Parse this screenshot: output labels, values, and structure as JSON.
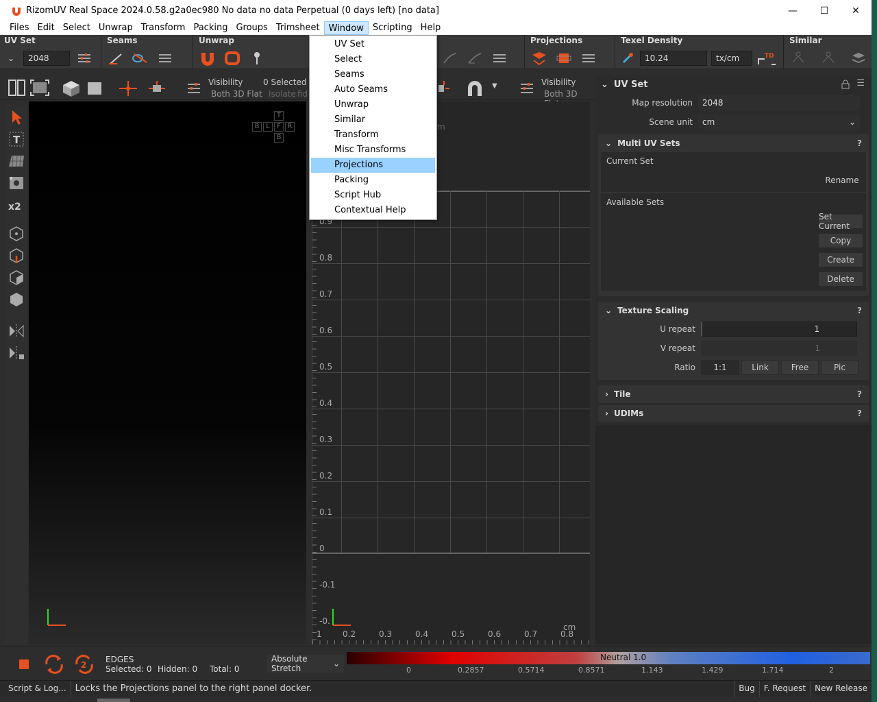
{
  "window": {
    "title": "RizomUV  Real Space 2024.0.58.g2a0ec980 No data no data Perpetual  (0 days left) [no data]",
    "minimize": "—",
    "maximize": "☐",
    "close": "✕"
  },
  "menu": [
    "Files",
    "Edit",
    "Select",
    "Unwrap",
    "Transform",
    "Packing",
    "Groups",
    "Trimsheet",
    "Window",
    "Scripting",
    "Help"
  ],
  "active_menu": "Window",
  "window_menu": {
    "items": [
      "UV Set",
      "Select",
      "Seams",
      "Auto Seams",
      "Unwrap",
      "Similar",
      "Transform",
      "Misc Transforms",
      "Projections",
      "Packing",
      "Script Hub",
      "Contextual Help"
    ],
    "highlighted": "Projections"
  },
  "toolbar": {
    "uvset_title": "UV Set",
    "uvset_value": "2048",
    "seams_title": "Seams",
    "unwrap_title": "Unwrap",
    "projections_title": "Projections",
    "texel_title": "Texel Density",
    "texel_value": "10.24",
    "texel_unit": "tx/cm",
    "similar_title": "Similar"
  },
  "viewbar": {
    "visibility_label": "Visibility",
    "visibility_mode": "Both 3D Flat",
    "selected_count": "0 Selected",
    "isolate": "Isolate",
    "fid": "fid",
    "visibility_label_2": "Visibility",
    "visibility_mode_2": "Both 3D Flat"
  },
  "cube_nav": {
    "top": "T",
    "back": "B",
    "left": "L",
    "front": "F",
    "right": "R",
    "bottom": "B"
  },
  "uv_axis": {
    "y_ticks": [
      "0.9",
      "0.8",
      "0.7",
      "0.6",
      "0.5",
      "0.4",
      "0.3",
      "0.2",
      "0.1",
      "0",
      "-0.1",
      "-0."
    ],
    "x_ticks": [
      "1",
      "0.2",
      "0.3",
      "0.4",
      "0.5",
      "0.6",
      "0.7",
      "0.8"
    ],
    "unit": "cm",
    "unit_top": "m"
  },
  "uvset_panel": {
    "title": "UV Set",
    "map_resolution_label": "Map resolution",
    "map_resolution_value": "2048",
    "scene_unit_label": "Scene unit",
    "scene_unit_value": "cm"
  },
  "multi_uv": {
    "title": "Multi UV Sets",
    "current_set": "Current Set",
    "rename": "Rename",
    "available_sets": "Available Sets",
    "set_current": "Set Current",
    "copy": "Copy",
    "create": "Create",
    "delete": "Delete"
  },
  "texture_scaling": {
    "title": "Texture Scaling",
    "u_repeat_label": "U repeat",
    "u_repeat_value": "1",
    "v_repeat_label": "V repeat",
    "v_repeat_value": "1",
    "ratio_label": "Ratio",
    "ratio_options": [
      "1:1",
      "Link",
      "Free",
      "Pic"
    ]
  },
  "collapsed_sections": [
    "Tile",
    "UDIMs"
  ],
  "help_mark": "?",
  "status": {
    "mode": "EDGES",
    "selected": "Selected: 0",
    "hidden": "Hidden: 0",
    "total": "Total: 0",
    "stretch_mode": "Absolute Stretch",
    "neutral": "Neutral 1.0",
    "scale": [
      "0",
      "0.2857",
      "0.5714",
      "0.8571",
      "1.143",
      "1.429",
      "1.714",
      "2"
    ]
  },
  "footer": {
    "script_log": "Script & Log...",
    "message": "Locks the Projections panel to the right panel docker.",
    "bug": "Bug",
    "feature": "F. Request",
    "release": "New Release"
  },
  "colors": {
    "accent": "#e8501e",
    "highlight": "#99d1ff"
  }
}
